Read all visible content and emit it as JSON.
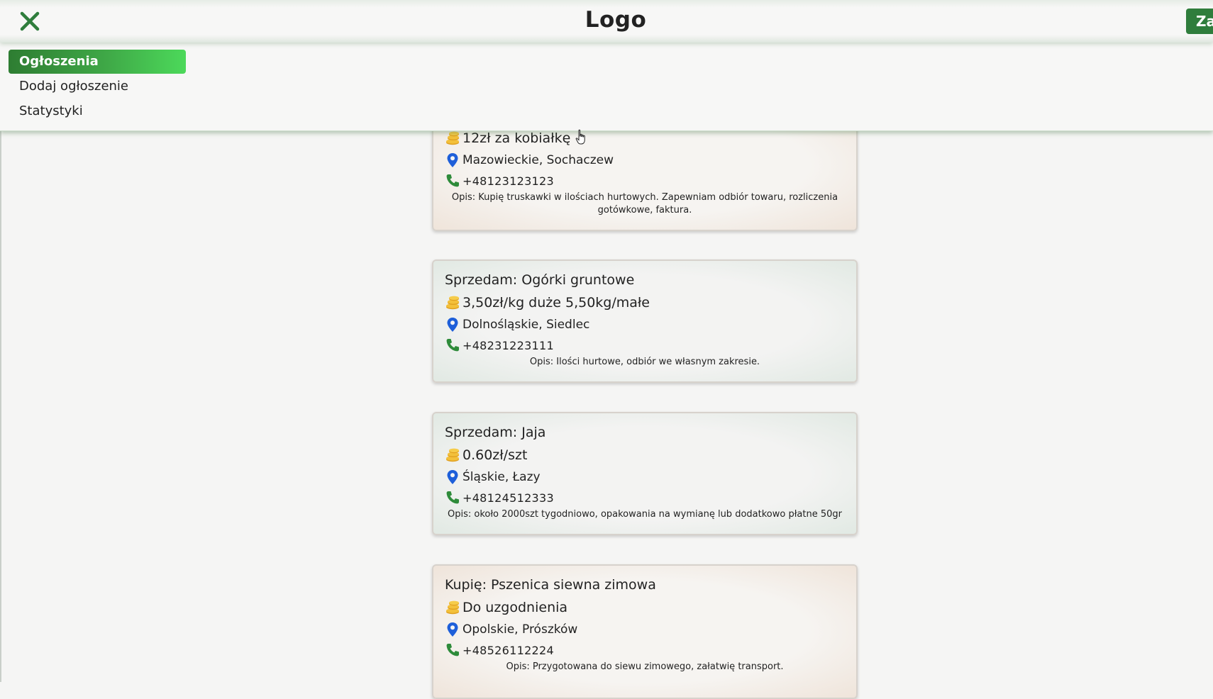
{
  "header": {
    "title": "Logo",
    "action_label": "Za"
  },
  "nav": {
    "items": [
      {
        "label": "Ogłoszenia",
        "active": true
      },
      {
        "label": "Dodaj ogłoszenie",
        "active": false
      },
      {
        "label": "Statystyki",
        "active": false
      }
    ]
  },
  "listings": [
    {
      "title": "",
      "price": "12zł za kobiałkę",
      "location": "Mazowieckie, Sochaczew",
      "phone": "+48123123123",
      "description": "Opis: Kupię truskawki w ilościach hurtowych. Zapewniam odbiór towaru, rozliczenia gotówkowe, faktura."
    },
    {
      "title": "Sprzedam: Ogórki gruntowe",
      "price": "3,50zł/kg duże 5,50kg/małe",
      "location": "Dolnośląskie, Siedlec",
      "phone": "+48231223111",
      "description": "Opis: Ilości hurtowe, odbiór we własnym zakresie."
    },
    {
      "title": "Sprzedam: Jaja",
      "price": "0.60zł/szt",
      "location": "Śląskie, Łazy",
      "phone": "+48124512333",
      "description": "Opis: około 2000szt tygodniowo, opakowania na wymianę lub dodatkowo płatne 50gr"
    },
    {
      "title": "Kupię: Pszenica siewna zimowa",
      "price": "Do uzgodnienia",
      "location": "Opolskie, Prószków",
      "phone": "+48526112224",
      "description": "Opis: Przygotowana do siewu zimowego, załatwię transport."
    }
  ],
  "icons": {
    "close": "close-icon",
    "price": "coins-icon",
    "location": "map-pin-icon",
    "phone": "phone-icon"
  },
  "colors": {
    "brand_green": "#2f7d3c",
    "active_gradient_end": "#4cd95a",
    "pin_blue": "#1e5fd9",
    "phone_green": "#2e8b3a",
    "coin_gold": "#f0b429"
  }
}
